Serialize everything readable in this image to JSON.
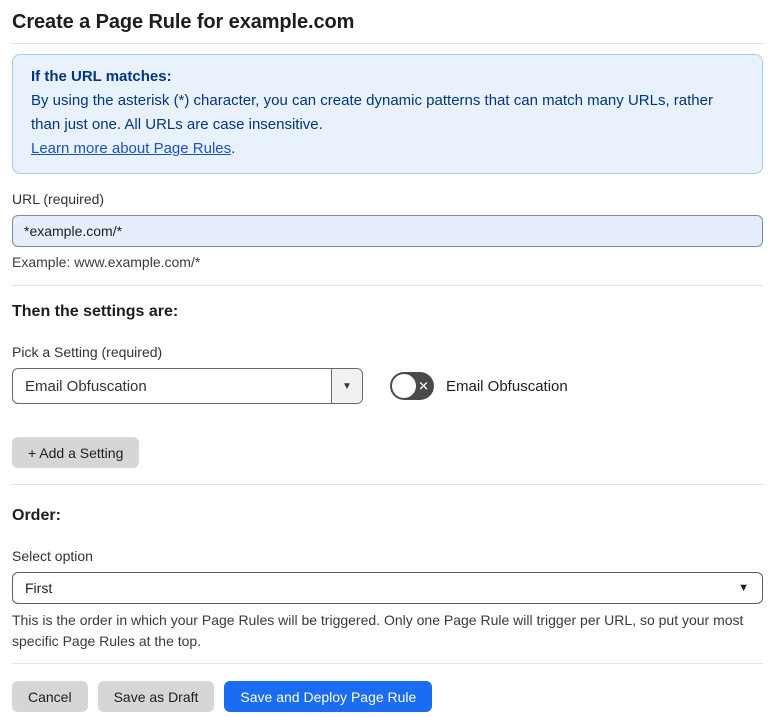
{
  "page": {
    "title": "Create a Page Rule for example.com"
  },
  "callout": {
    "heading": "If the URL matches:",
    "body": "By using the asterisk (*) character, you can create dynamic patterns that can match many URLs, rather than just one. All URLs are case insensitive.",
    "link_label": "Learn more about Page Rules",
    "link_suffix": "."
  },
  "url_field": {
    "label": "URL (required)",
    "value": "*example.com/*",
    "example": "Example: www.example.com/*"
  },
  "settings": {
    "heading": "Then the settings are:",
    "pick_label": "Pick a Setting (required)",
    "selected_setting": "Email Obfuscation",
    "caret_glyph": "▼",
    "toggle_label": "Email Obfuscation",
    "toggle_state": "off",
    "toggle_off_glyph": "✕",
    "add_button_label": "+ Add a Setting"
  },
  "order": {
    "heading": "Order:",
    "select_label": "Select option",
    "selected_option": "First",
    "caret_glyph": "▼",
    "help": "This is the order in which your Page Rules will be triggered. Only one Page Rule will trigger per URL, so put your most specific Page Rules at the top."
  },
  "footer": {
    "cancel_label": "Cancel",
    "save_draft_label": "Save as Draft",
    "save_deploy_label": "Save and Deploy Page Rule"
  },
  "colors": {
    "primary_button_blue": "#1a6cf0",
    "callout_background": "#e9f2fc",
    "callout_border": "#a9cbee",
    "callout_text": "#003681",
    "link_blue": "#1a52c9",
    "url_input_background": "#e6eefb",
    "toggle_off_track": "#4a4a4a",
    "gray_button": "#d6d6d6"
  }
}
